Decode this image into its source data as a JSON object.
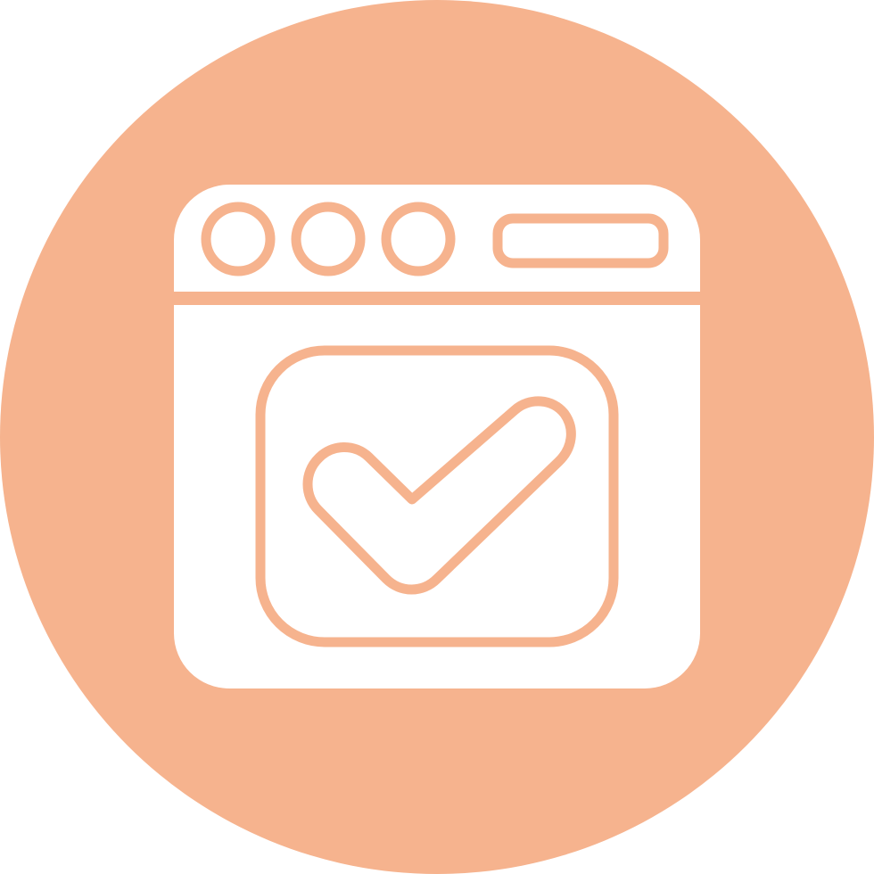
{
  "icon": {
    "name": "browser-window-checkmark-icon",
    "colors": {
      "circle": "#F6B38E",
      "glyph": "#FFFFFF",
      "line": "#F6B38E"
    },
    "parts": [
      "window-control-dot",
      "window-control-dot",
      "window-control-dot",
      "address-bar",
      "checkbox",
      "checkmark"
    ]
  }
}
